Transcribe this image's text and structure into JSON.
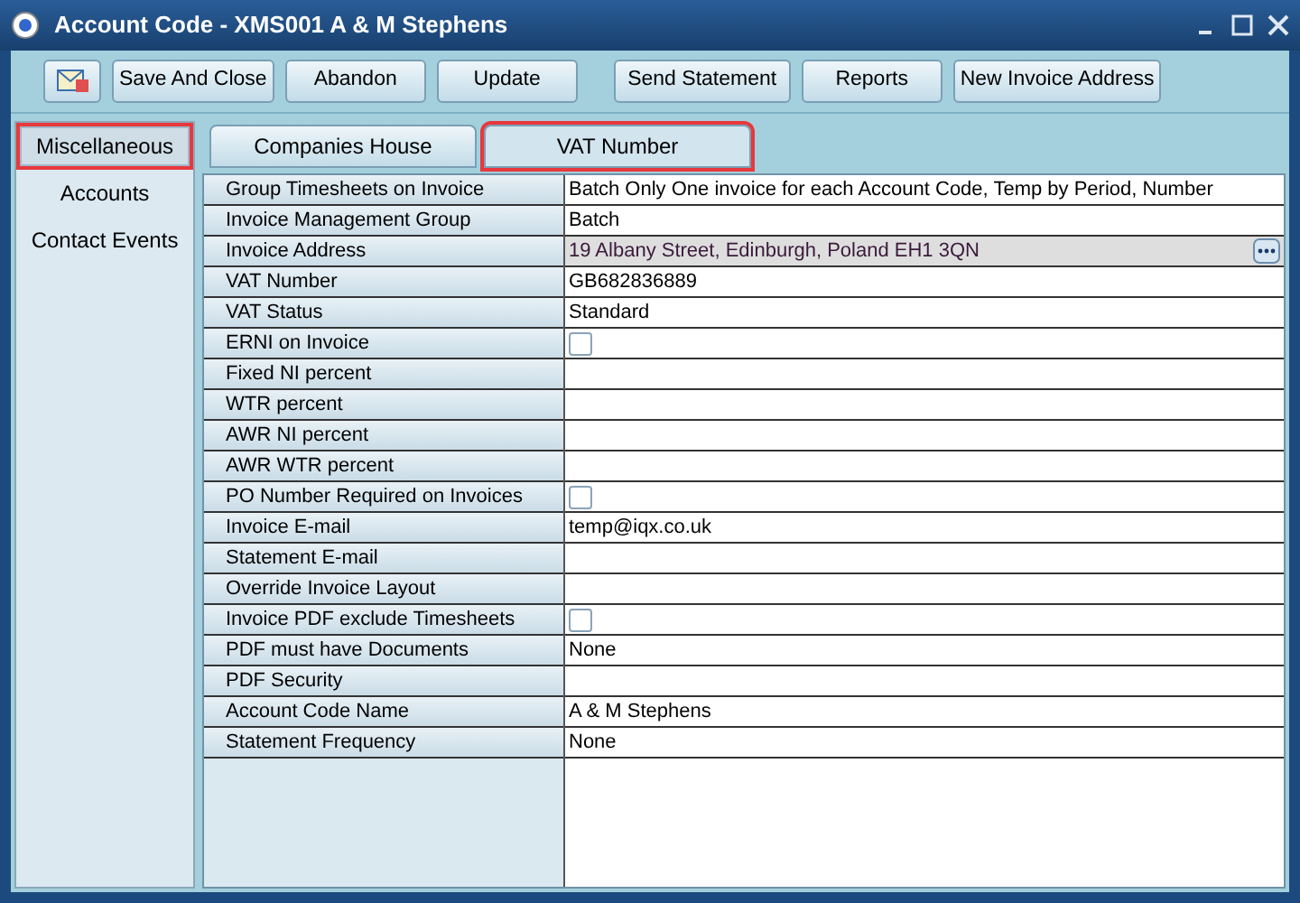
{
  "window": {
    "title": "Account Code - XMS001 A & M Stephens"
  },
  "toolbar": {
    "buttons": [
      "Save And Close",
      "Abandon",
      "Update",
      "Send Statement",
      "Reports",
      "New Invoice Address"
    ]
  },
  "sidebar": {
    "items": [
      {
        "label": "Miscellaneous",
        "selected": true,
        "highlighted": true
      },
      {
        "label": "Accounts",
        "selected": false,
        "highlighted": false
      },
      {
        "label": "Contact Events",
        "selected": false,
        "highlighted": false
      }
    ]
  },
  "tabs": [
    {
      "label": "Companies House",
      "selected": false,
      "highlighted": false
    },
    {
      "label": "VAT Number",
      "selected": true,
      "highlighted": true
    }
  ],
  "grid": {
    "rows": [
      {
        "label": "Group Timesheets on Invoice",
        "kind": "text",
        "value": "Batch Only One invoice for each Account Code, Temp by Period, Number"
      },
      {
        "label": "Invoice Management Group",
        "kind": "text",
        "value": "Batch"
      },
      {
        "label": "Invoice Address",
        "kind": "lookup",
        "value": "19 Albany Street, Edinburgh, Poland EH1 3QN"
      },
      {
        "label": "VAT Number",
        "kind": "text",
        "value": "GB682836889"
      },
      {
        "label": "VAT Status",
        "kind": "text",
        "value": "Standard"
      },
      {
        "label": "ERNI on Invoice",
        "kind": "checkbox",
        "checked": false
      },
      {
        "label": "Fixed NI percent",
        "kind": "text"
      },
      {
        "label": "WTR percent",
        "kind": "text"
      },
      {
        "label": "AWR NI percent",
        "kind": "text"
      },
      {
        "label": "AWR WTR percent",
        "kind": "text"
      },
      {
        "label": "PO Number Required on Invoices",
        "kind": "checkbox",
        "checked": false
      },
      {
        "label": "Invoice E-mail",
        "kind": "text",
        "value": "temp@iqx.co.uk"
      },
      {
        "label": "Statement E-mail",
        "kind": "text"
      },
      {
        "label": "Override Invoice Layout",
        "kind": "text"
      },
      {
        "label": "Invoice PDF exclude Timesheets",
        "kind": "checkbox",
        "checked": false
      },
      {
        "label": "PDF must have Documents",
        "kind": "text",
        "value": "None"
      },
      {
        "label": "PDF Security",
        "kind": "text"
      },
      {
        "label": "Account Code Name",
        "kind": "text",
        "value": "A & M Stephens"
      },
      {
        "label": "Statement Frequency",
        "kind": "text",
        "value": "None"
      }
    ]
  }
}
